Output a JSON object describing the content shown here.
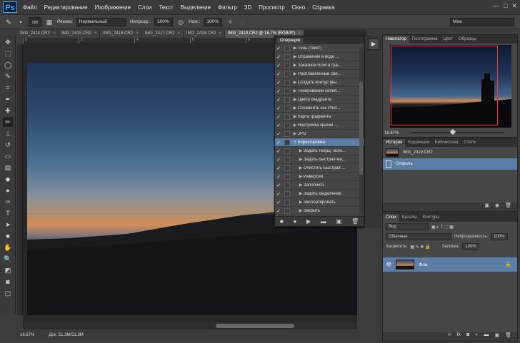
{
  "app": {
    "logo": "Ps"
  },
  "menubar": {
    "items": [
      "Файл",
      "Редактирование",
      "Изображение",
      "Слои",
      "Текст",
      "Выделение",
      "Фильтр",
      "3D",
      "Просмотр",
      "Окно",
      "Справка"
    ],
    "window_controls": {
      "minimize": "—",
      "maximize": "□",
      "close": "✕"
    }
  },
  "options": {
    "brush_size": "185",
    "mode_label": "Режим:",
    "mode_value": "Нормальный",
    "opacity_label": "Непрозр.:",
    "opacity_value": "100%",
    "flow_label": "Наж.:",
    "flow_value": "100%",
    "workspace": "Мое"
  },
  "tabs": [
    {
      "label": "IMG_2414.CR2",
      "close": "×"
    },
    {
      "label": "IMG_2415.CR2",
      "close": "×"
    },
    {
      "label": "IMG_2416.CR2",
      "close": "×"
    },
    {
      "label": "IMG_2417.CR2",
      "close": "×"
    },
    {
      "label": "IMG_2418.CR2",
      "close": "×"
    },
    {
      "label": "IMG_2419.CR2 @ 16,7% (RGB/8*)",
      "close": "×"
    }
  ],
  "rulers": {
    "top": [
      "0",
      "2",
      "4",
      "6",
      "8",
      "10"
    ]
  },
  "status": {
    "zoom": "16.67%",
    "doc": "Док: 51,3M/51,3M"
  },
  "actions_panel": {
    "title": "Операции",
    "rows": [
      {
        "label": "Тень (текст)",
        "check": "✓",
        "has_box": false,
        "selected": false,
        "sub": false
      },
      {
        "label": "Отражение в воде ...",
        "check": "✓",
        "has_box": false,
        "selected": false,
        "sub": false
      },
      {
        "label": "Заказной RGB в гра...",
        "check": "✓",
        "has_box": true,
        "selected": false,
        "sub": false
      },
      {
        "label": "Расплавленный сви...",
        "check": "✓",
        "has_box": false,
        "selected": false,
        "sub": false
      },
      {
        "label": "Создать контур (вы...",
        "check": "✓",
        "has_box": true,
        "selected": false,
        "sub": false
      },
      {
        "label": "Тонирование сепия...",
        "check": "✓",
        "has_box": false,
        "selected": false,
        "sub": false
      },
      {
        "label": "Цвета квадранта",
        "check": "✓",
        "has_box": false,
        "selected": false,
        "sub": false
      },
      {
        "label": "Сохранить как Phot...",
        "check": "✓",
        "has_box": true,
        "selected": false,
        "sub": false
      },
      {
        "label": "Карта градиента",
        "check": "✓",
        "has_box": false,
        "selected": false,
        "sub": false
      },
      {
        "label": "Настройка краски ...",
        "check": "✓",
        "has_box": true,
        "selected": false,
        "sub": false
      },
      {
        "label": "JPG",
        "check": "✓",
        "has_box": false,
        "selected": false,
        "sub": false
      },
      {
        "label": "Коректировка",
        "check": "✓",
        "has_box": false,
        "selected": true,
        "sub": false
      },
      {
        "label": "Задать текущ. коло...",
        "check": "✓",
        "has_box": false,
        "selected": false,
        "sub": true
      },
      {
        "label": "Задать быстрая ма...",
        "check": "✓",
        "has_box": false,
        "selected": false,
        "sub": true
      },
      {
        "label": "Очистить Быстрая ...",
        "check": "✓",
        "has_box": false,
        "selected": false,
        "sub": true
      },
      {
        "label": "Инверсия",
        "check": "✓",
        "has_box": false,
        "selected": false,
        "sub": true
      },
      {
        "label": "Заполнить",
        "check": "✓",
        "has_box": false,
        "selected": false,
        "sub": true
      },
      {
        "label": "Задать Выделение",
        "check": "✓",
        "has_box": false,
        "selected": false,
        "sub": true
      },
      {
        "label": "Экспортировать",
        "check": "✓",
        "has_box": false,
        "selected": false,
        "sub": true
      },
      {
        "label": "Закрыть",
        "check": "✓",
        "has_box": false,
        "selected": false,
        "sub": true
      }
    ],
    "footer_icons": [
      "■",
      "●",
      "▶",
      "▬",
      "▣",
      "🗑"
    ]
  },
  "navigator": {
    "tabs": [
      "Навигатор",
      "Гистограмма",
      "Цвет",
      "Образцы"
    ],
    "zoom": "16.67%"
  },
  "history": {
    "tabs": [
      "История",
      "Коррекция",
      "Библиотеки",
      "Стили"
    ],
    "snapshot": "IMG_2419.CR2",
    "step": "Открыть"
  },
  "layers": {
    "tabs": [
      "Слои",
      "Каналы",
      "Контуры"
    ],
    "filter": "Вид",
    "blend": "Обычные",
    "opacity_label": "Непрозрачность:",
    "opacity_value": "100%",
    "lock_label": "Закрепить:",
    "fill_label": "Заливка:",
    "fill_value": "100%",
    "layer_name": "Фон"
  },
  "colors": {
    "accent": "#5c7ea6",
    "nav_frame": "#ff3030"
  }
}
